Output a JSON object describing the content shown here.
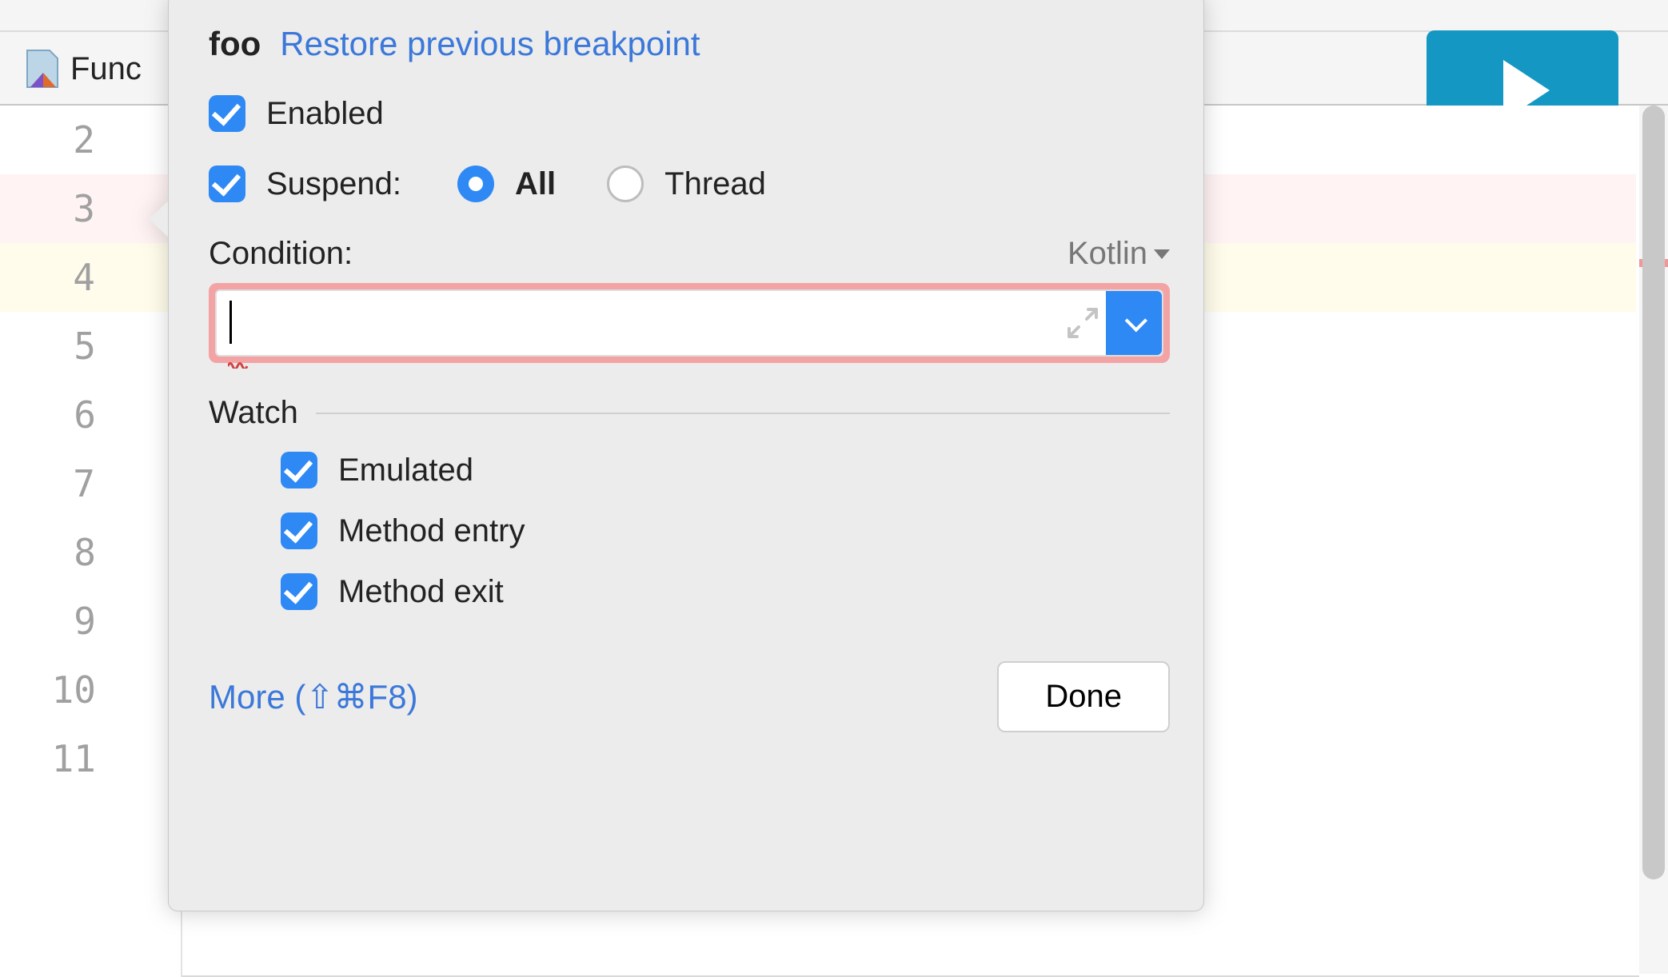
{
  "tab": {
    "filename_partial": "Func"
  },
  "gutter": {
    "lines": [
      "2",
      "3",
      "4",
      "5",
      "6",
      "7",
      "8",
      "9",
      "10",
      "11"
    ]
  },
  "popup": {
    "title_name": "foo",
    "restore_link": "Restore previous breakpoint",
    "enabled_label": "Enabled",
    "suspend_label": "Suspend:",
    "suspend_all": "All",
    "suspend_thread": "Thread",
    "condition_label": "Condition:",
    "language": "Kotlin",
    "condition_value": "",
    "watch_label": "Watch",
    "watch": {
      "emulated": "Emulated",
      "method_entry": "Method entry",
      "method_exit": "Method exit"
    },
    "more_link": "More (⇧⌘F8)",
    "done_label": "Done"
  }
}
